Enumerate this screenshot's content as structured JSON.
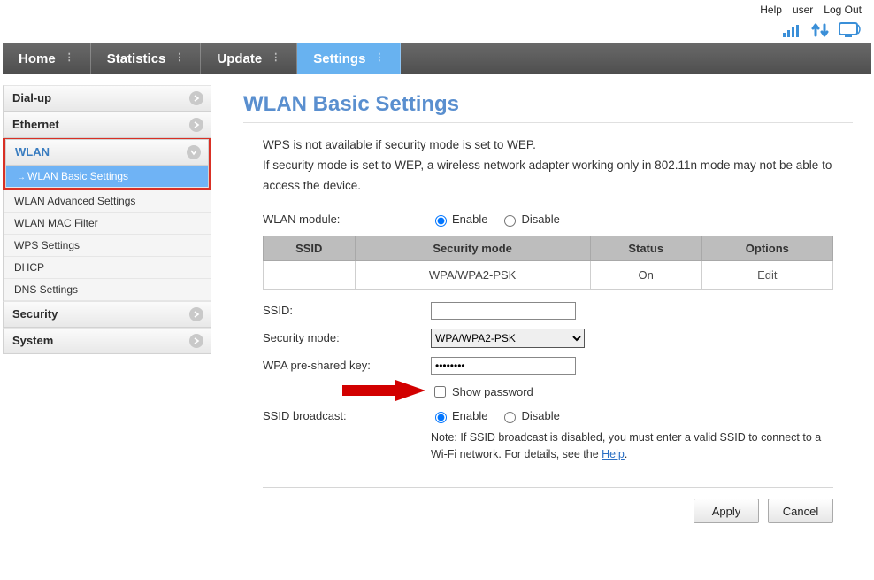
{
  "top_links": {
    "help": "Help",
    "user": "user",
    "logout": "Log Out"
  },
  "nav": {
    "home": "Home",
    "statistics": "Statistics",
    "update": "Update",
    "settings": "Settings"
  },
  "sidebar": {
    "dialup": "Dial-up",
    "ethernet": "Ethernet",
    "wlan": "WLAN",
    "wlan_sub": {
      "basic": "WLAN Basic Settings",
      "advanced": "WLAN Advanced Settings",
      "mac": "WLAN MAC Filter",
      "wps": "WPS Settings",
      "dhcp": "DHCP",
      "dns": "DNS Settings"
    },
    "security": "Security",
    "system": "System"
  },
  "page": {
    "title": "WLAN Basic Settings",
    "intro1": "WPS is not available if security mode is set to WEP.",
    "intro2": "If security mode is set to WEP, a wireless network adapter working only in 802.11n mode may not be able to access the device."
  },
  "labels": {
    "wlan_module": "WLAN module:",
    "enable": "Enable",
    "disable": "Disable",
    "ssid": "SSID:",
    "security_mode": "Security mode:",
    "wpa_key": "WPA pre-shared key:",
    "show_password": "Show password",
    "ssid_broadcast": "SSID broadcast:",
    "note": "Note: If SSID broadcast is disabled, you must enter a valid SSID to connect to a Wi-Fi network. For details, see the ",
    "help_link": "Help"
  },
  "table": {
    "h_ssid": "SSID",
    "h_sec": "Security mode",
    "h_status": "Status",
    "h_opt": "Options",
    "row": {
      "ssid": "",
      "sec": "WPA/WPA2-PSK",
      "status": "On",
      "opt": "Edit"
    }
  },
  "form_values": {
    "ssid": "",
    "security_mode": "WPA/WPA2-PSK",
    "wpa_key": "••••••••"
  },
  "buttons": {
    "apply": "Apply",
    "cancel": "Cancel"
  },
  "colors": {
    "accent": "#5a8fcf",
    "nav_active": "#68b2f0",
    "highlight": "#d93025",
    "icon_blue": "#3a8fd8"
  }
}
